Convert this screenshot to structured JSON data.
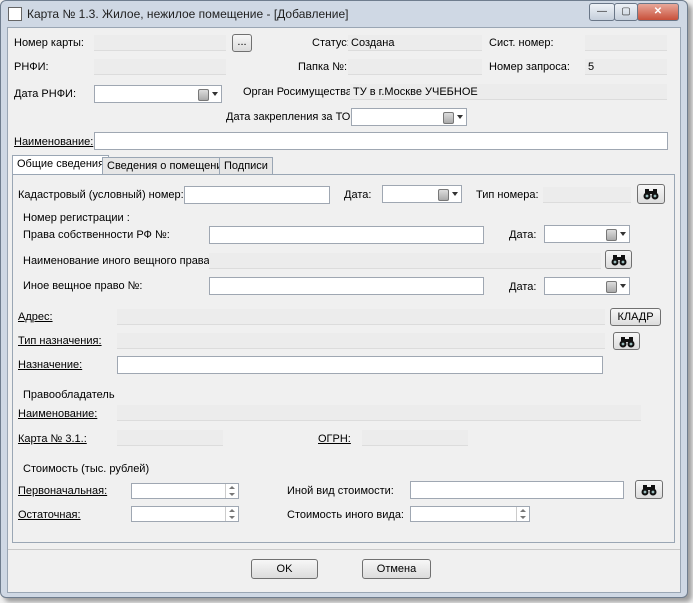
{
  "window": {
    "title": "Карта № 1.3. Жилое, нежилое помещение - [Добавление]",
    "minimize": "—",
    "maximize": "▢",
    "close": "✕"
  },
  "header": {
    "card_number_label": "Номер карты:",
    "card_number_value": "",
    "browse_label": "...",
    "status_label": "Статус:",
    "status_value": "Создана",
    "sys_number_label": "Сист. номер:",
    "sys_number_value": "",
    "rnfi_label": "РНФИ:",
    "rnfi_value": "",
    "folder_label": "Папка №:",
    "folder_value": "",
    "request_label": "Номер запроса:",
    "request_value": "5",
    "rnfi_date_label": "Дата РНФИ:",
    "rnfi_date_value": "",
    "organ_label": "Орган Росимущества:",
    "organ_value": "ТУ в г.Москве УЧЕБНОЕ",
    "assign_date_label": "Дата закрепления за ТО:",
    "assign_date_value": "",
    "name_label": "Наименование:",
    "name_value": ""
  },
  "tabs": [
    {
      "label": "Общие сведения"
    },
    {
      "label": "Сведения о помещении"
    },
    {
      "label": "Подписи"
    }
  ],
  "general": {
    "cadastral_label": "Кадастровый (условный) номер:",
    "cadastral_value": "",
    "date_label": "Дата:",
    "number_type_label": "Тип номера:",
    "number_type_value": "",
    "reg_number_label": "Номер регистрации :",
    "rf_rights_label": "Права собственности РФ №:",
    "rf_rights_value": "",
    "other_right_name_label": "Наименование иного вещного права:",
    "other_right_name_value": "",
    "other_right_label": "Иное вещное право  №:",
    "other_right_value": "",
    "address_label": "Адрес:",
    "address_value": "",
    "kladr_label": "КЛАДР",
    "purpose_type_label": "Тип назначения:",
    "purpose_type_value": "",
    "purpose_label": "Назначение:",
    "purpose_value": "",
    "holder_label": "Правообладатель",
    "holder_name_label": "Наименование:",
    "holder_name_value": "",
    "card31_label": "Карта № 3.1.:",
    "card31_value": "",
    "ogrn_label": "ОГРН:",
    "ogrn_value": "",
    "cost_label": "Стоимость (тыс. рублей)",
    "initial_label": "Первоначальная:",
    "initial_value": "",
    "residual_label": "Остаточная:",
    "residual_value": "",
    "other_cost_type_label": "Иной вид стоимости:",
    "other_cost_type_value": "",
    "other_cost_label": "Стоимость иного вида:",
    "other_cost_value": ""
  },
  "footer": {
    "ok_label": "OK",
    "cancel_label": "Отмена"
  },
  "icons": {
    "search": "binoculars-icon",
    "calendar": "calendar-icon",
    "dropdown": "chevron-down-icon"
  }
}
